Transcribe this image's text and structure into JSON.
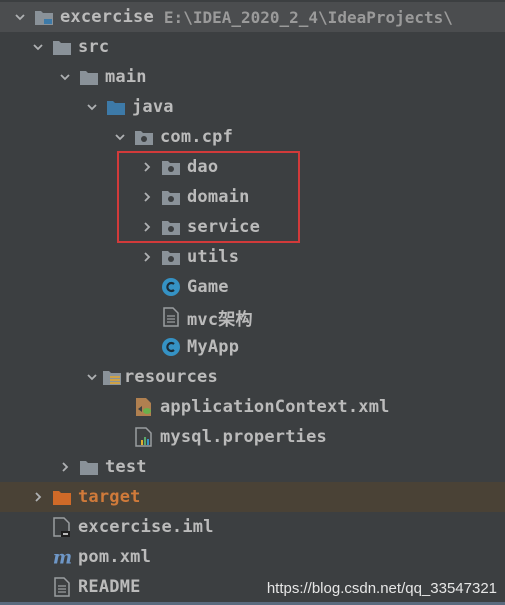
{
  "colors": {
    "background": "#3c3f41",
    "text": "#bbbbbb",
    "folder": "#8a9299",
    "source_folder": "#3d7aa8",
    "excluded_folder": "#d06a28",
    "excluded_row": "#4a4236",
    "class_icon": "#3592c4",
    "highlight_border": "#d23a3a"
  },
  "tree": {
    "rows": [
      {
        "label": "excercise",
        "path": "E:\\IDEA_2020_2_4\\IdeaProjects\\",
        "icon": "module-folder-icon",
        "arrow": "chevron-down-icon"
      },
      {
        "label": "src",
        "icon": "folder-icon",
        "arrow": "chevron-down-icon"
      },
      {
        "label": "main",
        "icon": "folder-icon",
        "arrow": "chevron-down-icon"
      },
      {
        "label": "java",
        "icon": "source-folder-icon",
        "arrow": "chevron-down-icon"
      },
      {
        "label": "com.cpf",
        "icon": "package-icon",
        "arrow": "chevron-down-icon"
      },
      {
        "label": "dao",
        "icon": "package-icon",
        "arrow": "chevron-right-icon"
      },
      {
        "label": "domain",
        "icon": "package-icon",
        "arrow": "chevron-right-icon"
      },
      {
        "label": "service",
        "icon": "package-icon",
        "arrow": "chevron-right-icon"
      },
      {
        "label": "utils",
        "icon": "package-icon",
        "arrow": "chevron-right-icon"
      },
      {
        "label": "Game",
        "icon": "java-class-icon"
      },
      {
        "label": "mvc架构",
        "icon": "text-file-icon"
      },
      {
        "label": "MyApp",
        "icon": "java-class-icon"
      },
      {
        "label": "resources",
        "icon": "resources-folder-icon",
        "arrow": "chevron-down-icon"
      },
      {
        "label": "applicationContext.xml",
        "icon": "spring-xml-icon"
      },
      {
        "label": "mysql.properties",
        "icon": "properties-file-icon"
      },
      {
        "label": "test",
        "icon": "folder-icon",
        "arrow": "chevron-right-icon"
      },
      {
        "label": "target",
        "icon": "excluded-folder-icon",
        "arrow": "chevron-right-icon"
      },
      {
        "label": "excercise.iml",
        "icon": "iml-file-icon"
      },
      {
        "label": "pom.xml",
        "icon": "maven-icon"
      },
      {
        "label": "README",
        "icon": "text-file-icon"
      }
    ]
  },
  "watermark": "https://blog.csdn.net/qq_33547321"
}
